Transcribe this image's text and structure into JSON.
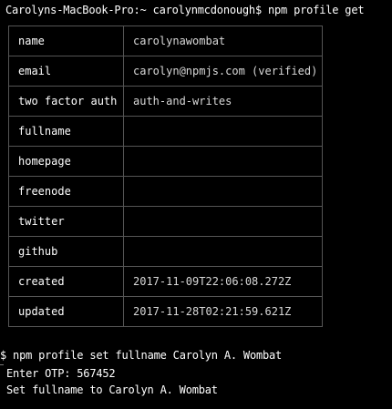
{
  "terminal": {
    "prompt": "Carolyns-MacBook-Pro:~ carolynmcdonough$ npm profile get",
    "profile_rows": [
      {
        "key": "name",
        "value": "carolynawombat"
      },
      {
        "key": "email",
        "value": "carolyn@npmjs.com (verified)"
      },
      {
        "key": "two factor auth",
        "value": "auth-and-writes"
      },
      {
        "key": "fullname",
        "value": ""
      },
      {
        "key": "homepage",
        "value": ""
      },
      {
        "key": "freenode",
        "value": ""
      },
      {
        "key": "twitter",
        "value": ""
      },
      {
        "key": "github",
        "value": ""
      },
      {
        "key": "created",
        "value": "2017-11-09T22:06:08.272Z"
      },
      {
        "key": "updated",
        "value": "2017-11-28T02:21:59.621Z"
      }
    ],
    "command_line": "$ npm profile set fullname Carolyn A. Wombat",
    "otp_line": "Enter OTP: 567452",
    "result_line": "Set fullname to Carolyn A. Wombat"
  },
  "colors": {
    "background": "#000000",
    "text": "#ffffff",
    "table_border": "#555555"
  }
}
